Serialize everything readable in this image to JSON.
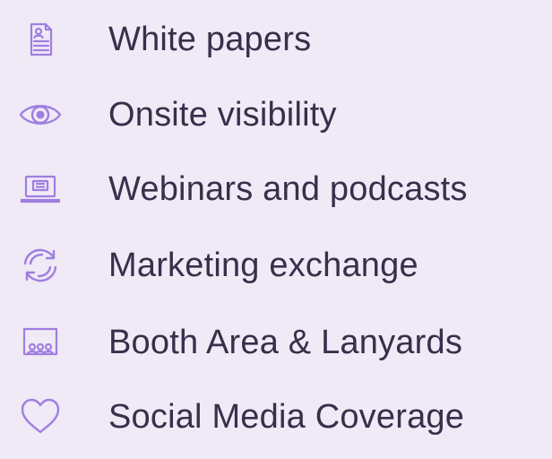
{
  "colors": {
    "background": "#efeaf6",
    "icon": "#a07ee0",
    "text": "#3a2e4a"
  },
  "items": [
    {
      "label": "White papers",
      "icon": "document-icon"
    },
    {
      "label": "Onsite visibility",
      "icon": "eye-icon"
    },
    {
      "label": "Webinars and podcasts",
      "icon": "laptop-icon"
    },
    {
      "label": "Marketing exchange",
      "icon": "sync-arrows-icon"
    },
    {
      "label": "Booth Area & Lanyards",
      "icon": "booth-icon"
    },
    {
      "label": "Social Media Coverage",
      "icon": "heart-icon"
    }
  ]
}
